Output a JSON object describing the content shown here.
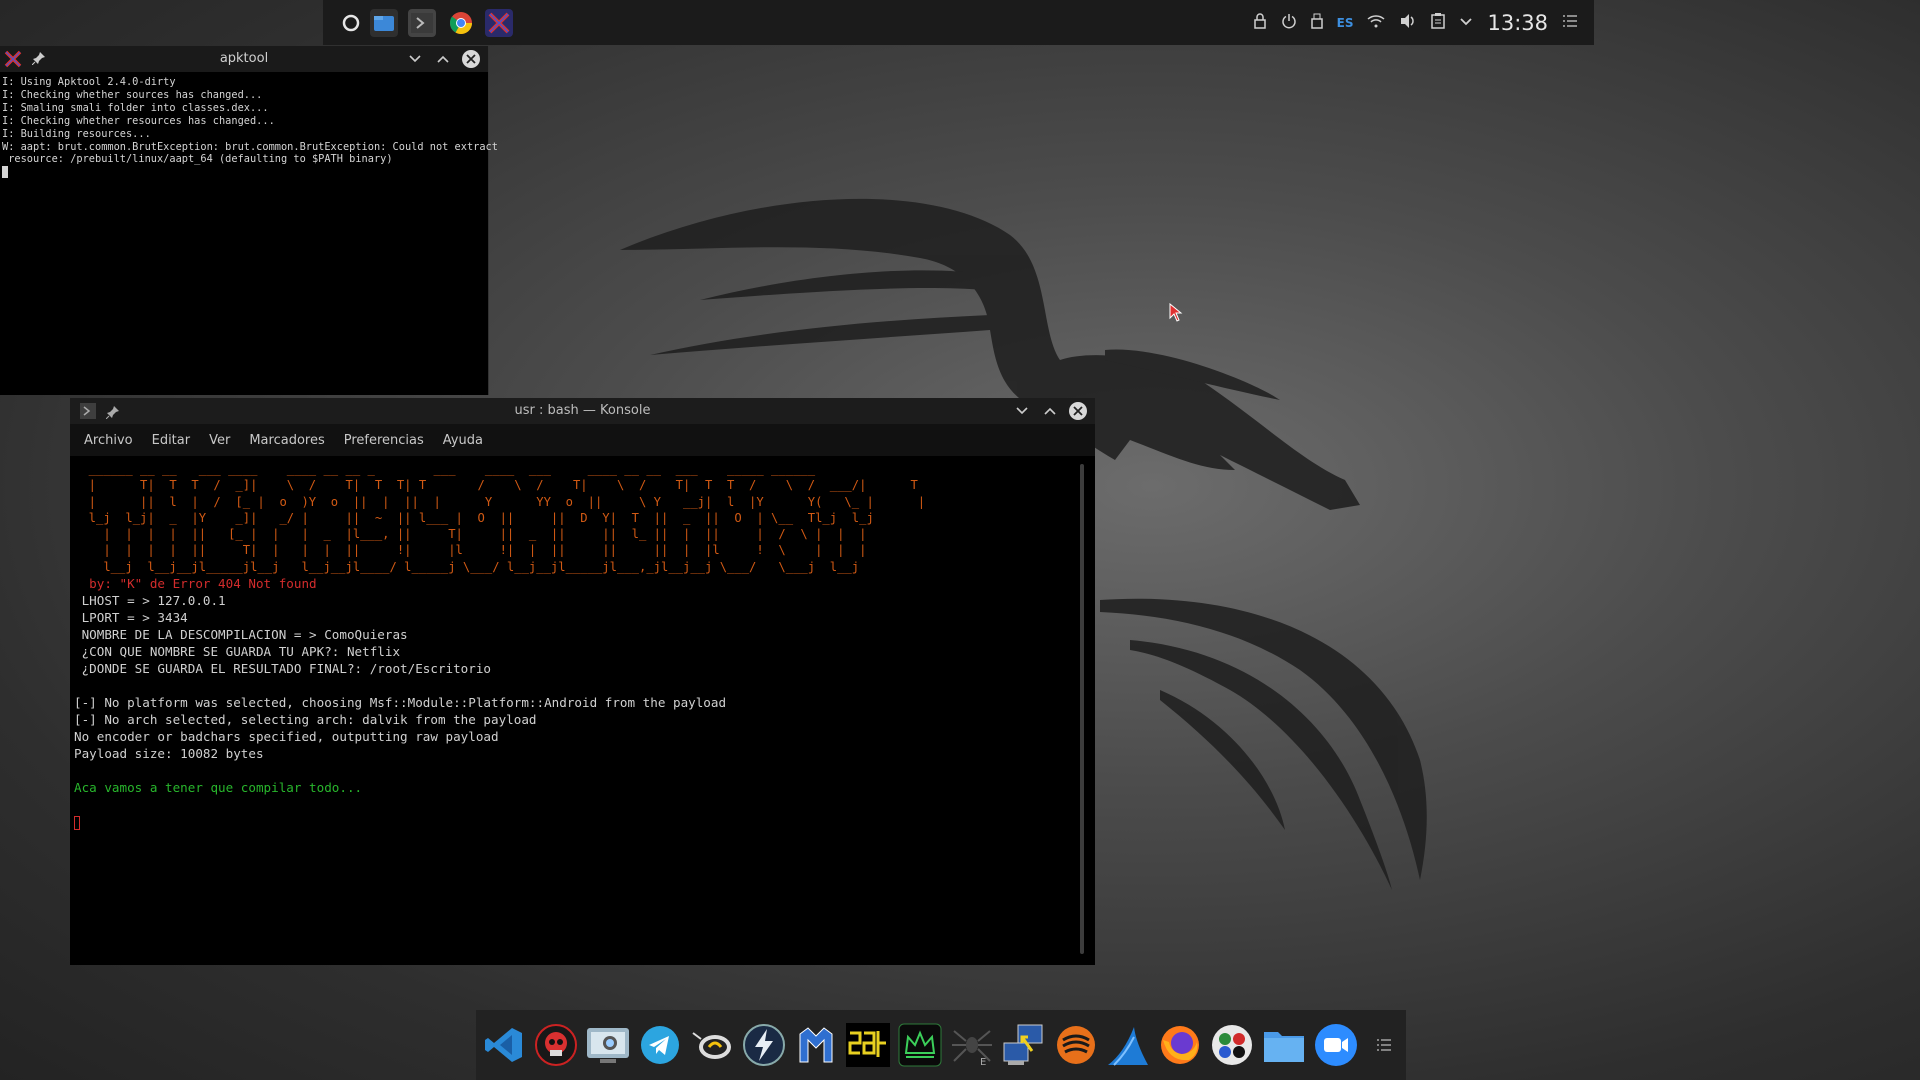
{
  "top_panel": {
    "tasks": [
      "circle-launcher-icon",
      "file-manager-icon",
      "terminal-icon",
      "chrome-icon",
      "xming-icon"
    ],
    "tray": {
      "lang": "ES",
      "clock": "13:38"
    }
  },
  "apktool_window": {
    "title": "apktool",
    "lines": [
      "I: Using Apktool 2.4.0-dirty",
      "I: Checking whether sources has changed...",
      "I: Smaling smali folder into classes.dex...",
      "I: Checking whether resources has changed...",
      "I: Building resources...",
      "W: aapt: brut.common.BrutException: brut.common.BrutException: Could not extract",
      " resource: /prebuilt/linux/aapt_64 (defaulting to $PATH binary)"
    ]
  },
  "konsole": {
    "title": "usr : bash — Konsole",
    "menu": [
      "Archivo",
      "Editar",
      "Ver",
      "Marcadores",
      "Preferencias",
      "Ayuda"
    ],
    "banner": [
      "  ______ __ __   ___ ____    ____ __ __ _        ___    ____  ___     ____ __ __  ___    _____ ______",
      "  |      T|  T  T  /  _]|    \\  /    T|  T  T| T       /    \\  /    T|    \\  /    T|  T  T  /    \\  /  ___/|      T",
      "  |      ||  l  |  /  [_ |  o  )Y  o  ||  |  ||  |      Y      YY  o  ||     \\ Y   __j|  l  |Y      Y(   \\_ |      |",
      "  l_j  l_j|  _  |Y    _]|   _/ |     ||  ~  || l___ |  O  ||     ||  D  Y|  T  ||  _  ||  O  | \\__  Tl_j  l_j",
      "    |  |  |  |  ||   [_ |  |   |  _  |l___, ||     T|     ||  _  ||     ||  l_ ||  |  ||     |  /  \\ |  |  |",
      "    |  |  |  |  ||     T|  |   |  |  ||     !|     |l     !|  |  ||     ||     ||  |  |l     !  \\    |  |  |",
      "    l__j  l__j__jl_____jl__j   l__j__jl____/ l_____j \\___/ l__j__jl_____jl___,_jl__j__j \\___/   \\___j  l__j"
    ],
    "author": "  by: \"K\" de Error 404 Not found",
    "info_lines": [
      " LHOST = > 127.0.0.1",
      " LPORT = > 3434",
      " NOMBRE DE LA DESCOMPILACION = > ComoQuieras",
      " ¿CON QUE NOMBRE SE GUARDA TU APK?: Netflix",
      " ¿DONDE SE GUARDA EL RESULTADO FINAL?: /root/Escritorio"
    ],
    "msf_lines": [
      "[-] No platform was selected, choosing Msf::Module::Platform::Android from the payload",
      "[-] No arch selected, selecting arch: dalvik from the payload",
      "No encoder or badchars specified, outputting raw payload",
      "Payload size: 10082 bytes"
    ],
    "status_line": "Aca vamos a tener que compilar todo..."
  },
  "dock": {
    "apps": [
      "vscode-icon",
      "red-skull-icon",
      "screenshot-icon",
      "telegram-icon",
      "wine-icon",
      "shark-lightning-icon",
      "malwarebytes-icon",
      "ascii-app-icon",
      "crown-terminal-icon",
      "spider-icon",
      "network-transfer-icon",
      "burp-icon",
      "wireshark-icon",
      "firefox-icon",
      "color-dots-icon",
      "folder-icon",
      "zoom-icon"
    ]
  }
}
